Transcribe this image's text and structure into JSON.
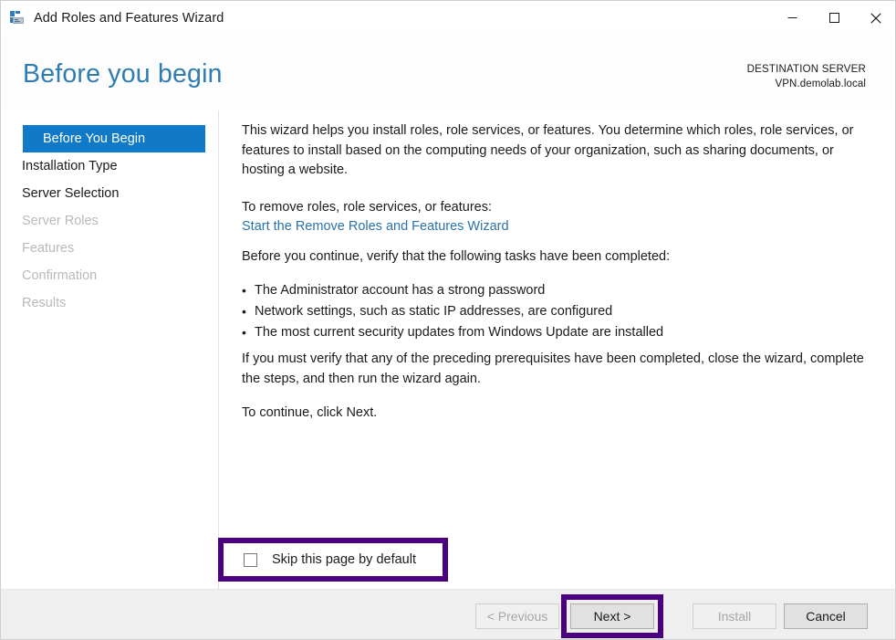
{
  "titlebar": {
    "title": "Add Roles and Features Wizard",
    "icon": "server-manager-icon",
    "minimize_label": "—",
    "maximize_label": "☐",
    "close_label": "✕"
  },
  "header": {
    "page_title": "Before you begin",
    "destination_label": "DESTINATION SERVER",
    "destination_value": "VPN.demolab.local"
  },
  "sidebar": {
    "items": [
      {
        "label": "Before You Begin",
        "state": "selected"
      },
      {
        "label": "Installation Type",
        "state": "enabled"
      },
      {
        "label": "Server Selection",
        "state": "enabled"
      },
      {
        "label": "Server Roles",
        "state": "disabled"
      },
      {
        "label": "Features",
        "state": "disabled"
      },
      {
        "label": "Confirmation",
        "state": "disabled"
      },
      {
        "label": "Results",
        "state": "disabled"
      }
    ]
  },
  "content": {
    "intro": "This wizard helps you install roles, role services, or features. You determine which roles, role services, or features to install based on the computing needs of your organization, such as sharing documents, or hosting a website.",
    "remove_intro": "To remove roles, role services, or features:",
    "remove_link": "Start the Remove Roles and Features Wizard",
    "verify_intro": "Before you continue, verify that the following tasks have been completed:",
    "bullet_marker": "•",
    "bullets": [
      "The Administrator account has a strong password",
      "Network settings, such as static IP addresses, are configured",
      "The most current security updates from Windows Update are installed"
    ],
    "prereq_note": "If you must verify that any of the preceding prerequisites have been completed, close the wizard, complete the steps, and then run the wizard again.",
    "continue_note": "To continue, click Next."
  },
  "skip_option": {
    "label": "Skip this page by default",
    "checked": false
  },
  "footer": {
    "buttons": [
      {
        "label": "< Previous",
        "enabled": false
      },
      {
        "label": "Next >",
        "enabled": true
      },
      {
        "label": "Install",
        "enabled": false
      },
      {
        "label": "Cancel",
        "enabled": true
      }
    ]
  },
  "annotations": {
    "highlight_color": "#4b0082",
    "highlighted_elements": [
      "skip-this-page-checkbox",
      "next-button"
    ]
  },
  "colors": {
    "accent_blue": "#1079c8",
    "title_blue": "#2e7cb0",
    "link_blue": "#2a72a8",
    "footer_grey": "#efefef",
    "annotation_purple": "#4b0082"
  }
}
